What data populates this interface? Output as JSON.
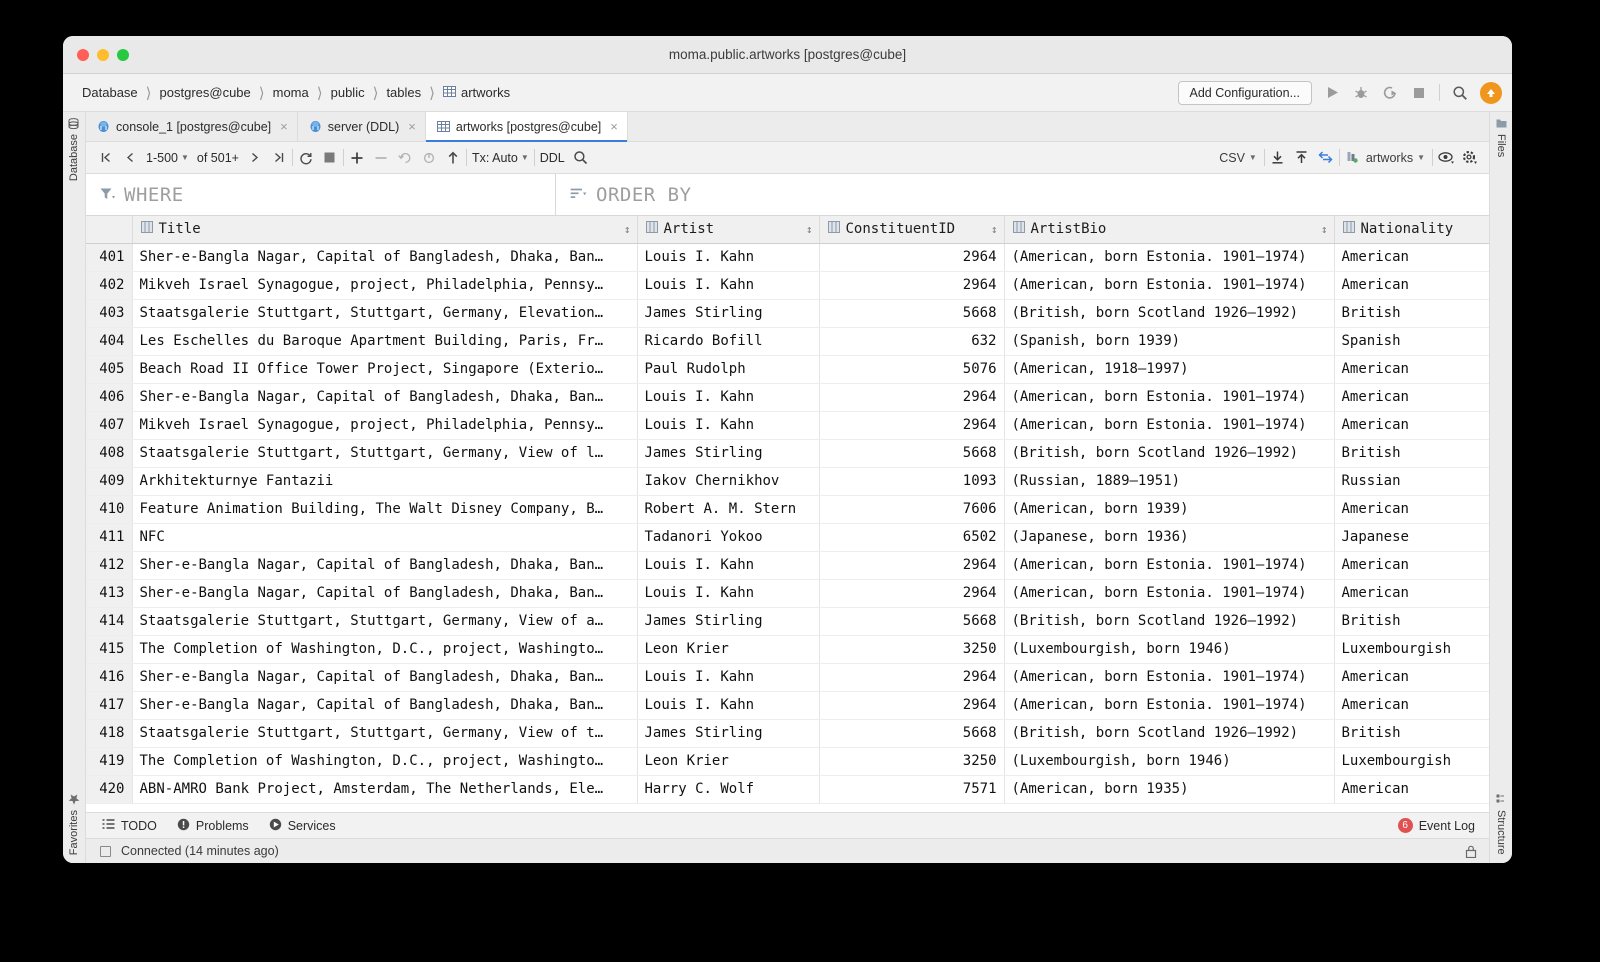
{
  "window": {
    "title": "moma.public.artworks [postgres@cube]"
  },
  "breadcrumb": {
    "items": [
      "Database",
      "postgres@cube",
      "moma",
      "public",
      "tables",
      "artworks"
    ],
    "separator": "〉"
  },
  "navbar": {
    "add_configuration_label": "Add Configuration...",
    "icons": [
      "run-icon",
      "debug-icon",
      "run-with-coverage-icon",
      "stop-icon",
      "search-everywhere-icon",
      "updates-icon"
    ]
  },
  "tabs": [
    {
      "label": "console_1 [postgres@cube]",
      "icon": "postgres-icon",
      "active": false,
      "close": "×"
    },
    {
      "label": "server (DDL)",
      "icon": "postgres-icon",
      "active": false,
      "close": "×"
    },
    {
      "label": "artworks [postgres@cube]",
      "icon": "table-icon",
      "active": true,
      "close": "×"
    }
  ],
  "gridbar": {
    "first_page": "first-page-icon",
    "prev_page": "prev-page-icon",
    "page_range": "1-500",
    "of_label": "of 501+",
    "next_page": "next-page-icon",
    "last_page": "last-page-icon",
    "reload": "reload-icon",
    "stop": "stop-icon",
    "add_row": "add-row-icon",
    "delete_row": "delete-row-icon",
    "revert": "revert-icon",
    "revert_selected": "revert-selected-icon",
    "submit": "submit-icon",
    "tx_label": "Tx: Auto",
    "ddl_label": "DDL",
    "search_icon": "search-icon",
    "format_label": "CSV",
    "export_icon": "export-to-file-icon",
    "import_icon": "import-from-file-icon",
    "compare_icon": "compare-with-icon",
    "datasource_label": "artworks",
    "view_icon": "eye-icon",
    "settings_icon": "gear-icon"
  },
  "filters": {
    "where_label": "WHERE",
    "where_icon": "filter-icon",
    "order_label": "ORDER BY",
    "order_icon": "sort-icon"
  },
  "grid": {
    "columns": [
      {
        "name": "Title",
        "icon": "column-icon",
        "sortable": true
      },
      {
        "name": "Artist",
        "icon": "column-icon",
        "sortable": true
      },
      {
        "name": "ConstituentID",
        "icon": "column-icon",
        "sortable": true
      },
      {
        "name": "ArtistBio",
        "icon": "column-icon",
        "sortable": true
      },
      {
        "name": "Nationality",
        "icon": "column-icon",
        "sortable": false
      }
    ],
    "rows": [
      {
        "n": "401",
        "Title": "Sher-e-Bangla Nagar, Capital of Bangladesh, Dhaka, Ban…",
        "Artist": "Louis I. Kahn",
        "ConstituentID": "2964",
        "ArtistBio": "(American, born Estonia. 1901–1974)",
        "Nationality": "American"
      },
      {
        "n": "402",
        "Title": "Mikveh Israel Synagogue, project, Philadelphia, Pennsy…",
        "Artist": "Louis I. Kahn",
        "ConstituentID": "2964",
        "ArtistBio": "(American, born Estonia. 1901–1974)",
        "Nationality": "American"
      },
      {
        "n": "403",
        "Title": "Staatsgalerie Stuttgart, Stuttgart, Germany, Elevation…",
        "Artist": "James Stirling",
        "ConstituentID": "5668",
        "ArtistBio": "(British, born Scotland 1926–1992)",
        "Nationality": "British"
      },
      {
        "n": "404",
        "Title": "Les Eschelles du Baroque Apartment Building, Paris, Fr…",
        "Artist": "Ricardo Bofill",
        "ConstituentID": "632",
        "ArtistBio": "(Spanish, born 1939)",
        "Nationality": "Spanish"
      },
      {
        "n": "405",
        "Title": "Beach Road II Office Tower Project, Singapore (Exterio…",
        "Artist": "Paul Rudolph",
        "ConstituentID": "5076",
        "ArtistBio": "(American, 1918–1997)",
        "Nationality": "American"
      },
      {
        "n": "406",
        "Title": "Sher-e-Bangla Nagar, Capital of Bangladesh, Dhaka, Ban…",
        "Artist": "Louis I. Kahn",
        "ConstituentID": "2964",
        "ArtistBio": "(American, born Estonia. 1901–1974)",
        "Nationality": "American"
      },
      {
        "n": "407",
        "Title": "Mikveh Israel Synagogue, project, Philadelphia, Pennsy…",
        "Artist": "Louis I. Kahn",
        "ConstituentID": "2964",
        "ArtistBio": "(American, born Estonia. 1901–1974)",
        "Nationality": "American"
      },
      {
        "n": "408",
        "Title": "Staatsgalerie Stuttgart, Stuttgart, Germany, View of l…",
        "Artist": "James Stirling",
        "ConstituentID": "5668",
        "ArtistBio": "(British, born Scotland 1926–1992)",
        "Nationality": "British"
      },
      {
        "n": "409",
        "Title": "Arkhitekturnye Fantazii",
        "Artist": "Iakov Chernikhov",
        "ConstituentID": "1093",
        "ArtistBio": "(Russian, 1889–1951)",
        "Nationality": "Russian"
      },
      {
        "n": "410",
        "Title": "Feature Animation Building, The Walt Disney Company, B…",
        "Artist": "Robert A. M. Stern",
        "ConstituentID": "7606",
        "ArtistBio": "(American, born 1939)",
        "Nationality": "American"
      },
      {
        "n": "411",
        "Title": "NFC",
        "Artist": "Tadanori Yokoo",
        "ConstituentID": "6502",
        "ArtistBio": "(Japanese, born 1936)",
        "Nationality": "Japanese"
      },
      {
        "n": "412",
        "Title": "Sher-e-Bangla Nagar, Capital of Bangladesh, Dhaka, Ban…",
        "Artist": "Louis I. Kahn",
        "ConstituentID": "2964",
        "ArtistBio": "(American, born Estonia. 1901–1974)",
        "Nationality": "American"
      },
      {
        "n": "413",
        "Title": "Sher-e-Bangla Nagar, Capital of Bangladesh, Dhaka, Ban…",
        "Artist": "Louis I. Kahn",
        "ConstituentID": "2964",
        "ArtistBio": "(American, born Estonia. 1901–1974)",
        "Nationality": "American"
      },
      {
        "n": "414",
        "Title": "Staatsgalerie Stuttgart, Stuttgart, Germany, View of a…",
        "Artist": "James Stirling",
        "ConstituentID": "5668",
        "ArtistBio": "(British, born Scotland 1926–1992)",
        "Nationality": "British"
      },
      {
        "n": "415",
        "Title": "The Completion of Washington, D.C., project, Washingto…",
        "Artist": "Leon Krier",
        "ConstituentID": "3250",
        "ArtistBio": "(Luxembourgish, born 1946)",
        "Nationality": "Luxembourgish"
      },
      {
        "n": "416",
        "Title": "Sher-e-Bangla Nagar, Capital of Bangladesh, Dhaka, Ban…",
        "Artist": "Louis I. Kahn",
        "ConstituentID": "2964",
        "ArtistBio": "(American, born Estonia. 1901–1974)",
        "Nationality": "American"
      },
      {
        "n": "417",
        "Title": "Sher-e-Bangla Nagar, Capital of Bangladesh, Dhaka, Ban…",
        "Artist": "Louis I. Kahn",
        "ConstituentID": "2964",
        "ArtistBio": "(American, born Estonia. 1901–1974)",
        "Nationality": "American"
      },
      {
        "n": "418",
        "Title": "Staatsgalerie Stuttgart, Stuttgart, Germany, View of t…",
        "Artist": "James Stirling",
        "ConstituentID": "5668",
        "ArtistBio": "(British, born Scotland 1926–1992)",
        "Nationality": "British"
      },
      {
        "n": "419",
        "Title": "The Completion of Washington, D.C., project, Washingto…",
        "Artist": "Leon Krier",
        "ConstituentID": "3250",
        "ArtistBio": "(Luxembourgish, born 1946)",
        "Nationality": "Luxembourgish"
      },
      {
        "n": "420",
        "Title": "ABN-AMRO Bank Project, Amsterdam, The Netherlands, Ele…",
        "Artist": "Harry C. Wolf",
        "ConstituentID": "7571",
        "ArtistBio": "(American, born 1935)",
        "Nationality": "American"
      }
    ]
  },
  "left_strip": {
    "top_label": "Database",
    "bottom_label": "Favorites"
  },
  "right_strip": {
    "top_label": "Files",
    "bottom_label": "Structure"
  },
  "toolwindow_bar": {
    "todo_label": "TODO",
    "problems_label": "Problems",
    "services_label": "Services",
    "event_log_label": "Event Log",
    "event_log_count": "6"
  },
  "status_bar": {
    "message": "Connected (14 minutes ago)"
  },
  "colors": {
    "accent_blue": "#3b7ddd",
    "run_orange": "#f0961e",
    "badge_red": "#e05252",
    "green_dot": "#59a869"
  }
}
